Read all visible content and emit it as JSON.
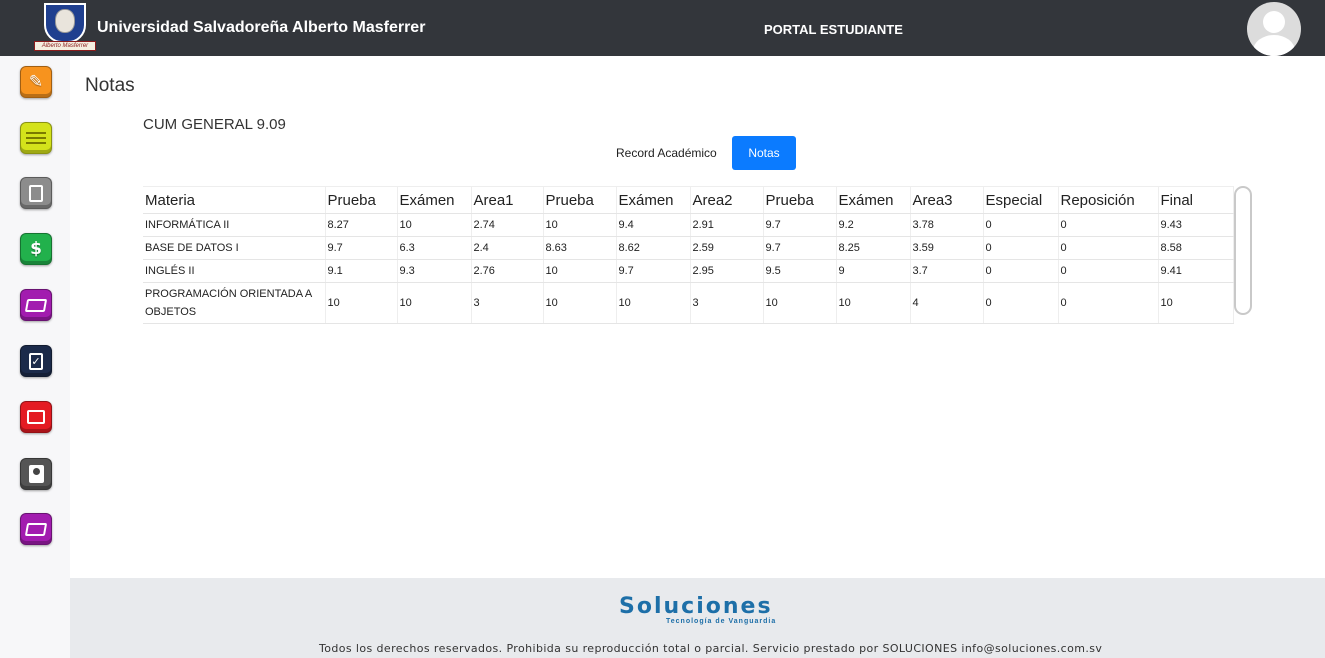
{
  "header": {
    "university_name": "Universidad Salvadoreña Alberto Masferrer",
    "logo_banner": "Alberto Masferrer",
    "portal_title": "PORTAL ESTUDIANTE"
  },
  "sidebar": {
    "items": [
      {
        "icon": "pen-icon",
        "color": "#f7931e"
      },
      {
        "icon": "list-icon",
        "color": "#d4e21b"
      },
      {
        "icon": "document-icon",
        "color": "#8c8c8c"
      },
      {
        "icon": "dollar-icon",
        "color": "#22b14c",
        "glyph": "$"
      },
      {
        "icon": "folder-icon",
        "color": "#a21caf"
      },
      {
        "icon": "checklist-icon",
        "color": "#1b2a4a"
      },
      {
        "icon": "box-icon",
        "color": "#e41b23"
      },
      {
        "icon": "contact-book-icon",
        "color": "#555555"
      },
      {
        "icon": "folder-icon",
        "color": "#a21caf"
      }
    ]
  },
  "main": {
    "page_title": "Notas",
    "cum": "CUM GENERAL 9.09",
    "record_link": "Record Académico",
    "notas_button": "Notas",
    "table": {
      "headers": [
        "Materia",
        "Prueba",
        "Exámen",
        "Area1",
        "Prueba",
        "Exámen",
        "Area2",
        "Prueba",
        "Exámen",
        "Area3",
        "Especial",
        "Reposición",
        "Final"
      ],
      "rows": [
        [
          "INFORMÁTICA II",
          "8.27",
          "10",
          "2.74",
          "10",
          "9.4",
          "2.91",
          "9.7",
          "9.2",
          "3.78",
          "0",
          "0",
          "9.43"
        ],
        [
          "BASE DE DATOS I",
          "9.7",
          "6.3",
          "2.4",
          "8.63",
          "8.62",
          "2.59",
          "9.7",
          "8.25",
          "3.59",
          "0",
          "0",
          "8.58"
        ],
        [
          "INGLÉS II",
          "9.1",
          "9.3",
          "2.76",
          "10",
          "9.7",
          "2.95",
          "9.5",
          "9",
          "3.7",
          "0",
          "0",
          "9.41"
        ],
        [
          "PROGRAMACIÓN ORIENTADA A OBJETOS",
          "10",
          "10",
          "3",
          "10",
          "10",
          "3",
          "10",
          "10",
          "4",
          "0",
          "0",
          "10"
        ]
      ]
    }
  },
  "footer": {
    "brand": "Soluciones",
    "tagline": "Tecnología de Vanguardia",
    "copyright": "Todos los derechos reservados. Prohibida su reproducción total o parcial. Servicio prestado por SOLUCIONES info@soluciones.com.sv"
  }
}
